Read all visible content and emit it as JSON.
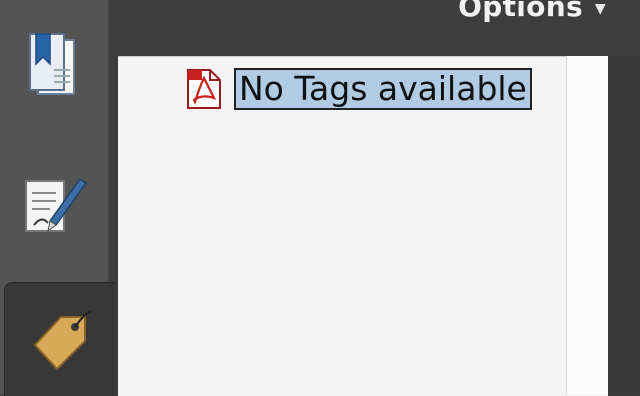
{
  "header": {
    "options_label": "Options"
  },
  "rail": {
    "items": [
      {
        "icon": "bookmarks-icon"
      },
      {
        "icon": "signatures-icon"
      },
      {
        "icon": "tags-icon",
        "active": true
      }
    ]
  },
  "tags_panel": {
    "root_item": {
      "icon": "pdf-file-icon",
      "label": "No Tags available"
    }
  }
}
